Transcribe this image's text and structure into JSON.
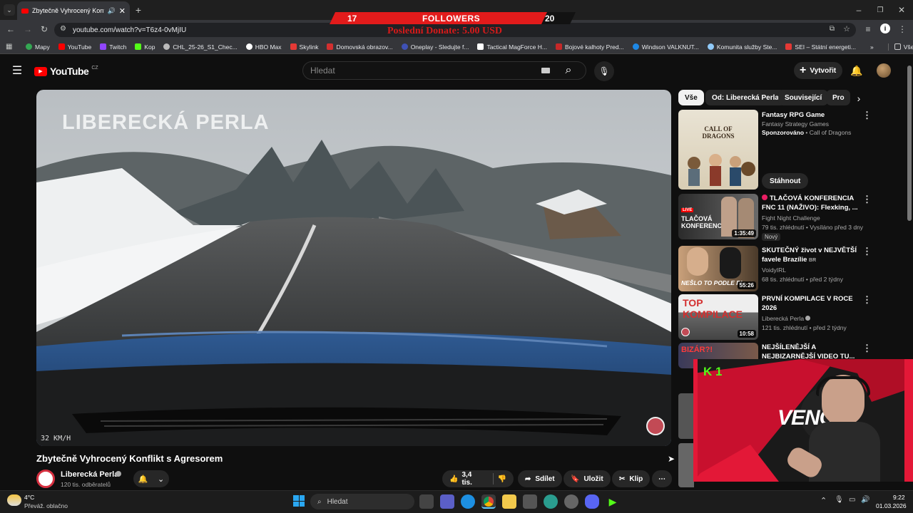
{
  "browser": {
    "tab_title": "Zbytečně Vyhrocený Konfli",
    "url": "youtube.com/watch?v=T6z4-0vMjIU",
    "bookmarks": [
      "Mapy",
      "YouTube",
      "Twitch",
      "Kop",
      "CHL_25-26_S1_Chec...",
      "HBO Max",
      "Skylink",
      "Domovská obrazov...",
      "Oneplay - Sledujte f...",
      "Tactical MagForce H...",
      "Bojové kalhoty Pred...",
      "Windson VALKNUT...",
      "Komunita služby Ste...",
      "SEI – Státní energeti..."
    ],
    "bookmarks_more": "»",
    "all_bookmarks": "Všechny záložky"
  },
  "overlay": {
    "left_count": "17",
    "title": "FOLLOWERS",
    "right_count": "20",
    "donate": "Poslední Donate: 5.00 USD"
  },
  "youtube": {
    "logo": "YouTube",
    "region": "CZ",
    "search_placeholder": "Hledat",
    "create_label": "Vytvořit"
  },
  "video": {
    "watermark": "LIBERECKÁ PERLA",
    "speed": "32 KM/H",
    "title": "Zbytečně Vyhrocený Konflikt s Agresorem",
    "channel": "Liberecká Perla",
    "subscribers": "120 tis. odběratelů",
    "likes": "3,4 tis.",
    "share": "Sdílet",
    "save": "Uložit",
    "clip": "Klip"
  },
  "chips": [
    "Vše",
    "Od: Liberecká Perla",
    "Související",
    "Pro"
  ],
  "related": [
    {
      "title": "Fantasy RPG Game",
      "line2": "Fantasy Strategy Games",
      "sponsor": "Sponzorováno",
      "sponsor_by": "• Call of Dragons",
      "cta": "Stáhnout",
      "thumb_text": "CALL OF DRAGONS"
    },
    {
      "title": "TLAČOVÁ KONFERENCIA FNC 11 (NAŽIVO): Flexking, ...",
      "channel": "Fight Night Challenge",
      "meta": "79 tis. zhlédnutí • Vysíláno před 3 dny",
      "badge": "Nový",
      "duration": "1:35:49",
      "thumb_text": "TLAČOVÁ KONFERENCIA",
      "live": "LIVE"
    },
    {
      "title": "SKUTEČNÝ život v NEJVĚTŠÍ favele Brazílie",
      "flag": "BR",
      "channel": "VoidyIRL",
      "meta": "68 tis. zhlédnutí • před 2 týdny",
      "duration": "55:26",
      "thumb_text": "NEŠLO TO PODLE PL"
    },
    {
      "title": "PRVNÍ KOMPILACE V ROCE 2026",
      "channel": "Liberecká Perla",
      "meta": "121 tis. zhlédnutí • před 2 týdny",
      "duration": "10:58",
      "thumb_text": "TOP KOMPILACE"
    },
    {
      "title": "NEJŠÍLENĚJŠÍ A NEJBIZARNĚJŠÍ VIDEO TU...",
      "thumb_text": "BIZÁR?!"
    }
  ],
  "webcam": {
    "brand": "K 1",
    "name": "VENCI"
  },
  "taskbar": {
    "weather_temp": "4°C",
    "weather_desc": "Převáž. oblačno",
    "search": "Hledat",
    "time": "9:22",
    "date": "01.03.2026"
  },
  "colors": {
    "accent": "#ff0000",
    "overlay_red": "#e21b1b",
    "bg": "#0f0f0f"
  }
}
